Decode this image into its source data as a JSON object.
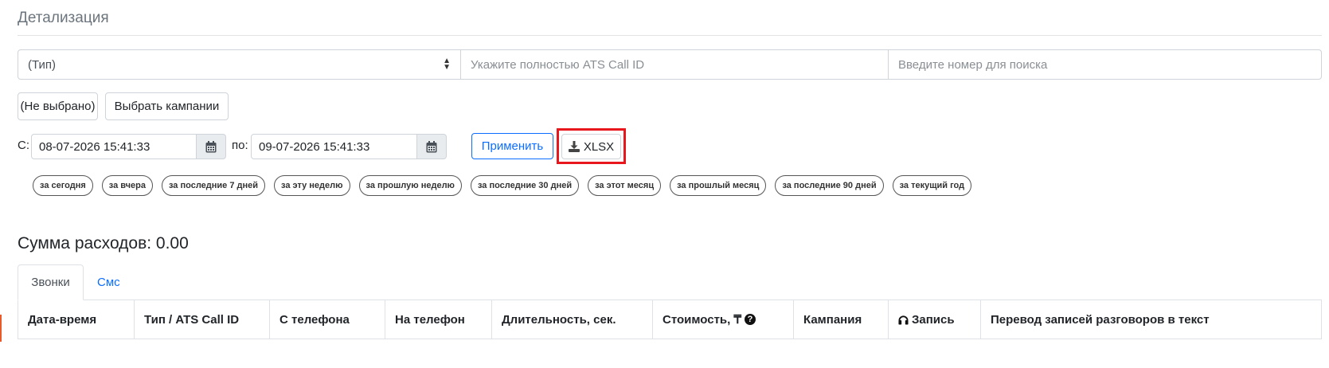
{
  "page_title": "Детализация",
  "filters": {
    "type_select_value": "(Тип)",
    "call_id_placeholder": "Укажите полностью ATS Call ID",
    "phone_placeholder": "Введите номер для поиска"
  },
  "campaign": {
    "selected_label": "(Не выбрано)",
    "choose_button": "Выбрать кампании"
  },
  "date_range": {
    "from_label": "С:",
    "from_value": "08-07-2026 15:41:33",
    "to_label": "по:",
    "to_value": "09-07-2026 15:41:33",
    "apply_button": "Применить",
    "export_button": "XLSX"
  },
  "period_shortcuts": [
    "за сегодня",
    "за вчера",
    "за последние 7 дней",
    "за эту неделю",
    "за прошлую неделю",
    "за последние 30 дней",
    "за этот месяц",
    "за прошлый месяц",
    "за последние 90 дней",
    "за текущий год"
  ],
  "expenses_label": "Сумма расходов: 0.00",
  "tabs": [
    {
      "label": "Звонки",
      "active": true
    },
    {
      "label": "Смс",
      "active": false
    }
  ],
  "table_headers": [
    "Дата-время",
    "Тип / ATS Call ID",
    "С телефона",
    "На телефон",
    "Длительность, сек.",
    "Стоимость, ₸",
    "Кампания",
    "Запись",
    "Перевод записей разговоров в текст"
  ],
  "icons": {
    "select_arrows": "sort-icon",
    "calendar": "calendar-icon",
    "download": "download-icon",
    "help": "question-circle-icon",
    "headphones": "headphones-icon"
  },
  "colors": {
    "primary": "#0d6efd",
    "highlight": "#e8161d",
    "accent": "#e8592c"
  }
}
